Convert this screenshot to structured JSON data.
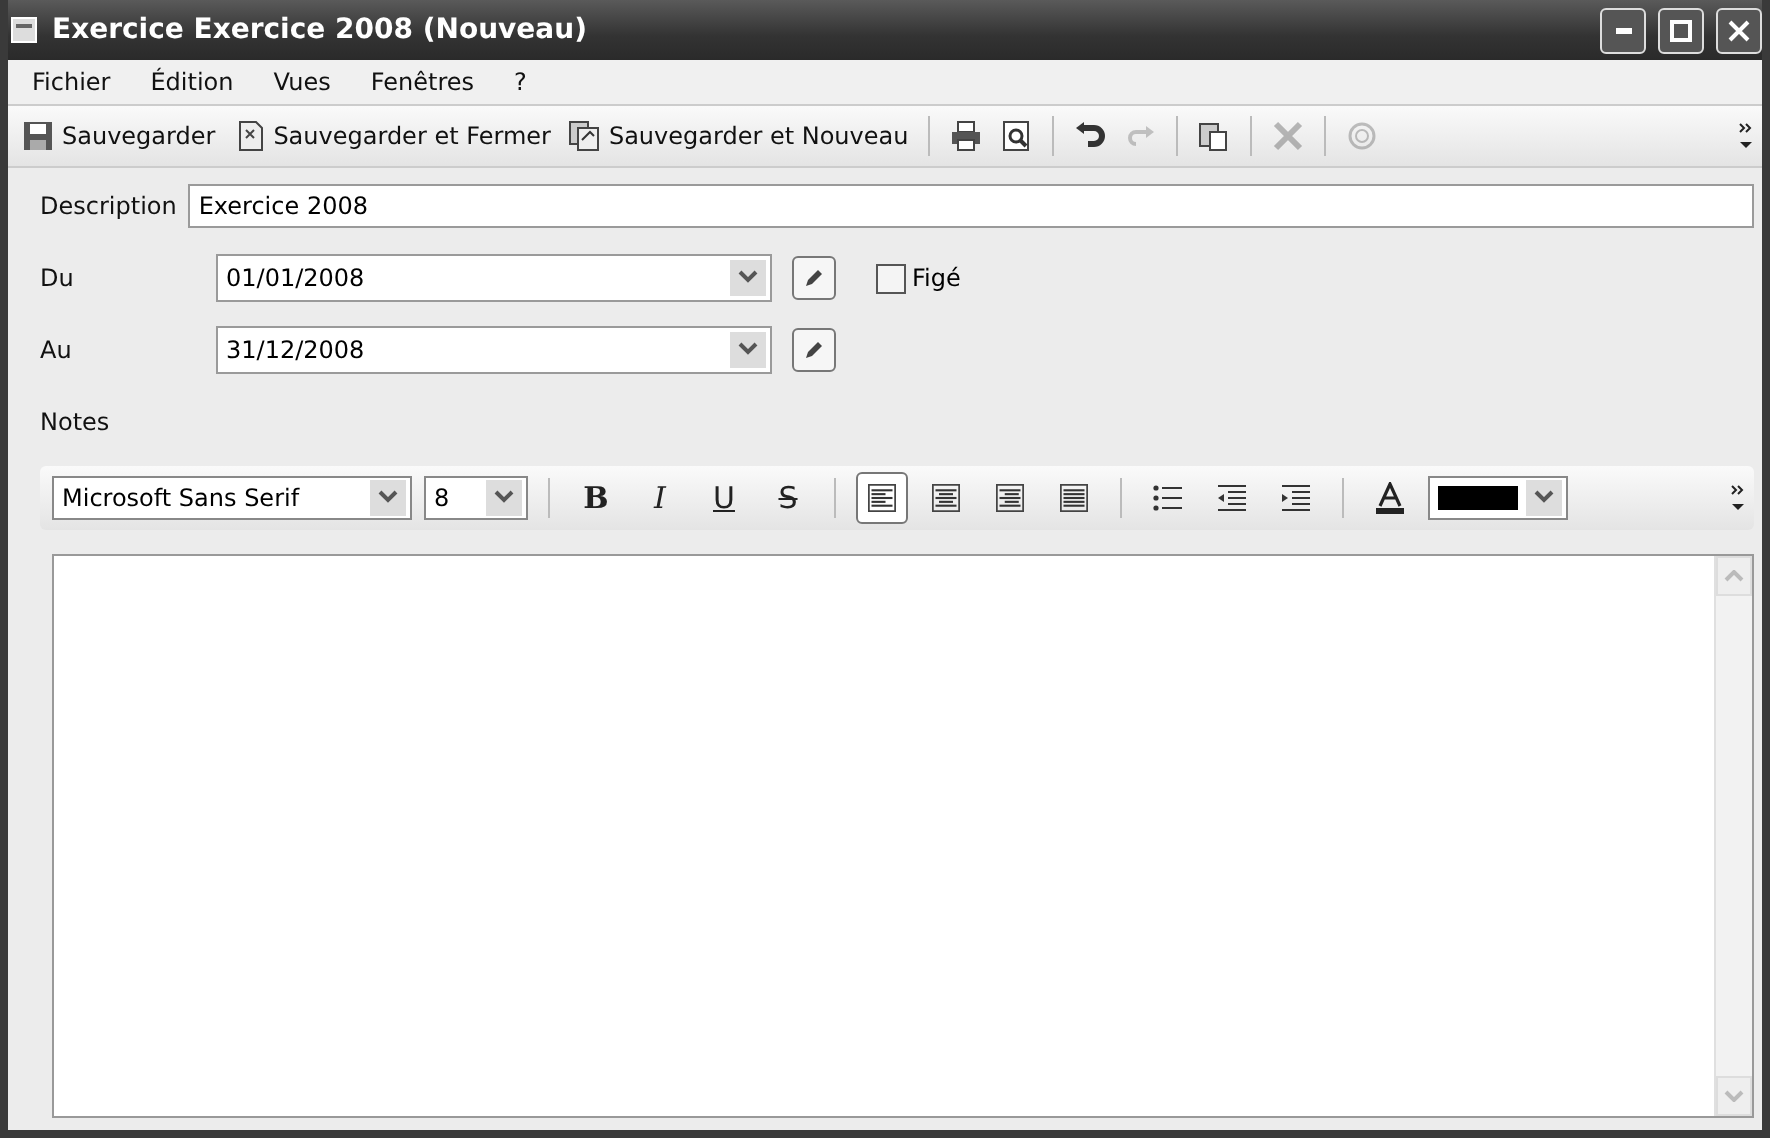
{
  "window": {
    "title": "Exercice Exercice 2008 (Nouveau)"
  },
  "menu": [
    "Fichier",
    "Édition",
    "Vues",
    "Fenêtres",
    "?"
  ],
  "toolbar": [
    {
      "kind": "text",
      "label": "Sauvegarder",
      "disabled": false
    },
    {
      "kind": "text",
      "label": "Sauvegarder et Fermer",
      "disabled": false
    },
    {
      "kind": "text",
      "label": "Sauvegarder et Nouveau",
      "disabled": false
    },
    {
      "kind": "sep"
    },
    {
      "kind": "icon",
      "disabled": false
    },
    {
      "kind": "icon",
      "disabled": false
    },
    {
      "kind": "sep"
    },
    {
      "kind": "icon",
      "disabled": false
    },
    {
      "kind": "icon",
      "disabled": true
    },
    {
      "kind": "sep"
    },
    {
      "kind": "icon",
      "disabled": false
    },
    {
      "kind": "sep"
    },
    {
      "kind": "icon",
      "disabled": true
    },
    {
      "kind": "sep"
    },
    {
      "kind": "icon",
      "disabled": true
    }
  ],
  "form": {
    "description": {
      "label": "Description",
      "value": "Exercice 2008"
    },
    "du": {
      "label": "Du",
      "value": "01/01/2008"
    },
    "au": {
      "label": "Au",
      "value": "31/12/2008"
    },
    "fige": {
      "label": "Figé",
      "checked": false
    },
    "notes_label": "Notes"
  },
  "format_toolbar": {
    "font": "Microsoft Sans Serif",
    "size": "8",
    "styles": [
      "B",
      "I",
      "U",
      "S"
    ],
    "align": [
      {
        "selected": true
      },
      {
        "selected": false
      },
      {
        "selected": false
      },
      {
        "selected": false
      }
    ],
    "color": "#000000"
  }
}
